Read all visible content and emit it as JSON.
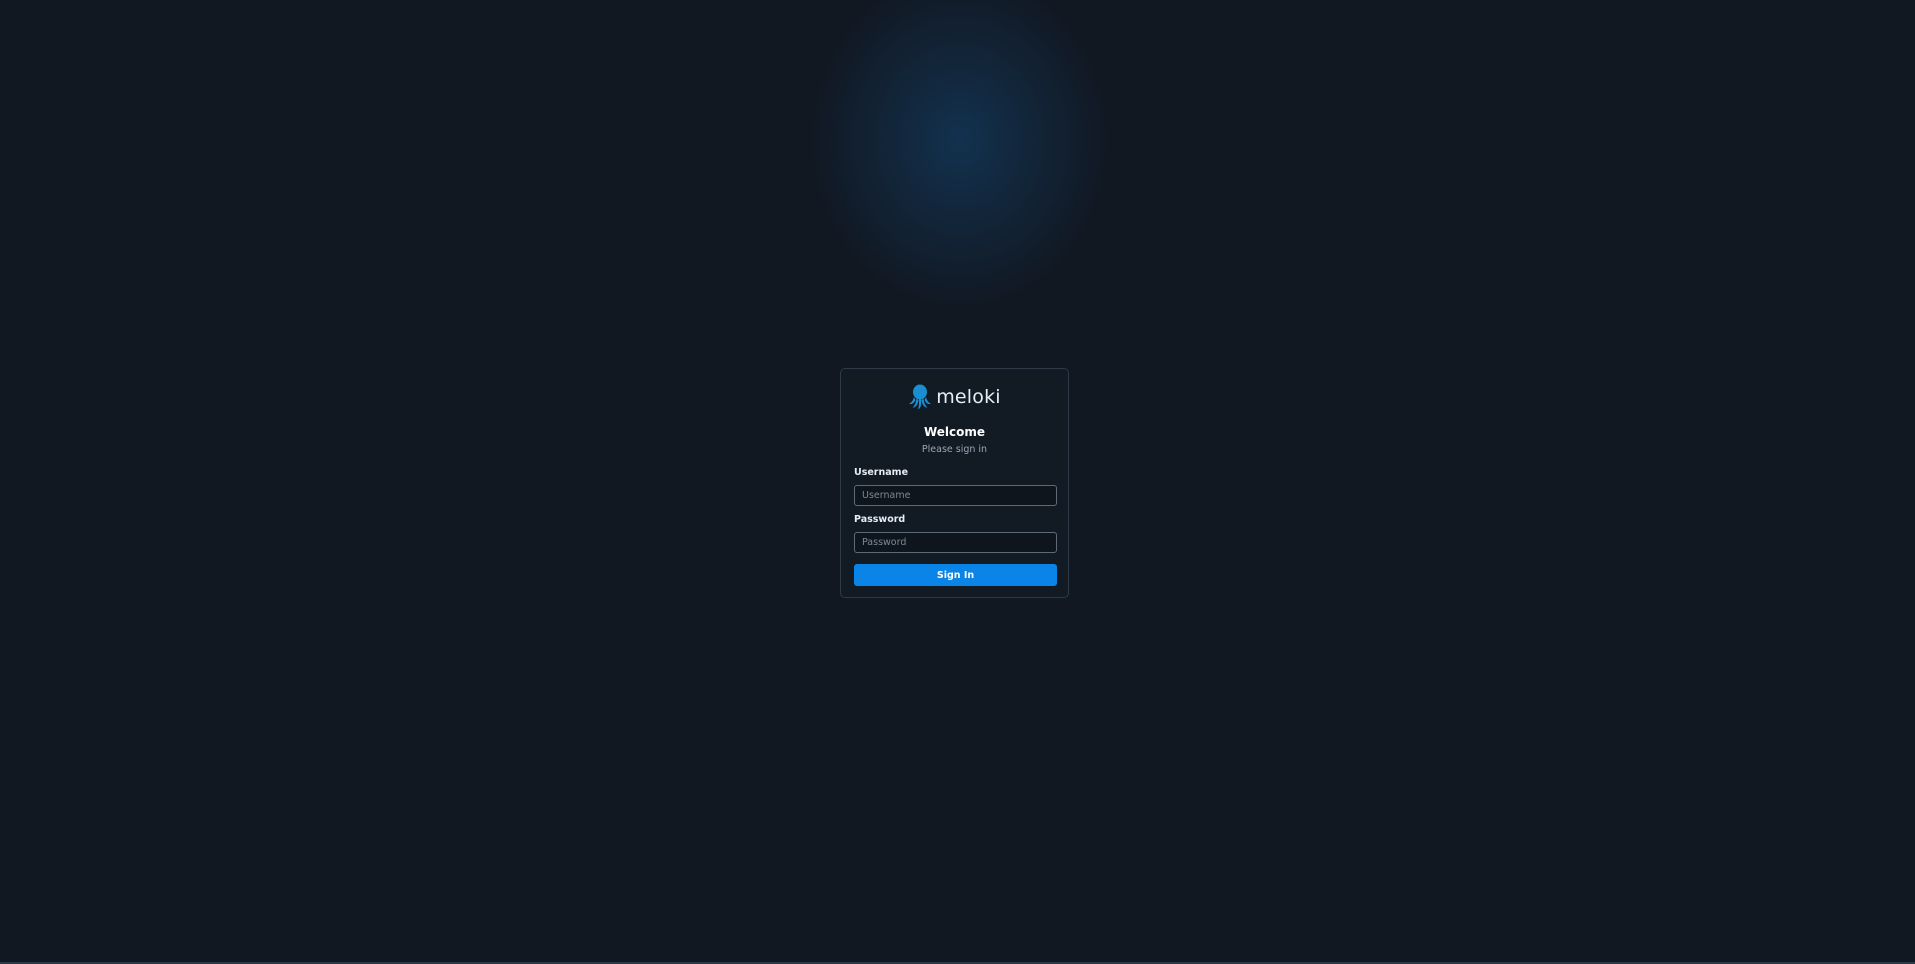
{
  "brand": {
    "name": "meloki",
    "logo_icon": "octopus-icon",
    "logo_color": "#1a8fd0"
  },
  "login": {
    "title": "Welcome",
    "subtitle": "Please sign in",
    "username": {
      "label": "Username",
      "placeholder": "Username",
      "value": ""
    },
    "password": {
      "label": "Password",
      "placeholder": "Password",
      "value": ""
    },
    "submit_label": "Sign In"
  },
  "colors": {
    "background": "#111822",
    "card_background": "#121a24",
    "accent": "#0a84e6"
  }
}
